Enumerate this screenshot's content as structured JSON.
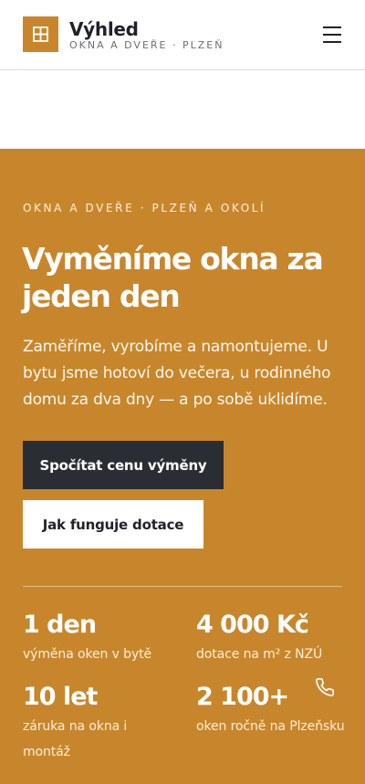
{
  "header": {
    "brand_name": "Výhled",
    "brand_tagline": "OKNA A DVEŘE · PLZEŇ",
    "logo_icon": "window-grid-icon",
    "menu_icon": "hamburger-menu-icon"
  },
  "hero": {
    "eyebrow": "OKNA A DVEŘE · PLZEŇ A OKOLÍ",
    "headline": "Vyměníme okna za jeden den",
    "lead": "Zaměříme, vyrobíme a namontujeme. U bytu jsme hotoví do večera, u rodinného domu za dva dny — a po sobě uklidíme.",
    "primary_button": "Spočítat cenu výměny",
    "secondary_button": "Jak funguje dotace",
    "stats": [
      {
        "value": "1 den",
        "label": "výměna oken v bytě"
      },
      {
        "value": "4 000 Kč",
        "label": "dotace na m² z NZÚ"
      },
      {
        "value": "10 let",
        "label": "záruka na okna i montáž"
      },
      {
        "value": "2 100+",
        "label": "oken ročně na Plzeňsku"
      }
    ],
    "phone_icon": "phone-icon"
  },
  "colors": {
    "accent": "#c8862c",
    "dark": "#2a2d33",
    "text": "#1f2228",
    "white": "#ffffff"
  }
}
